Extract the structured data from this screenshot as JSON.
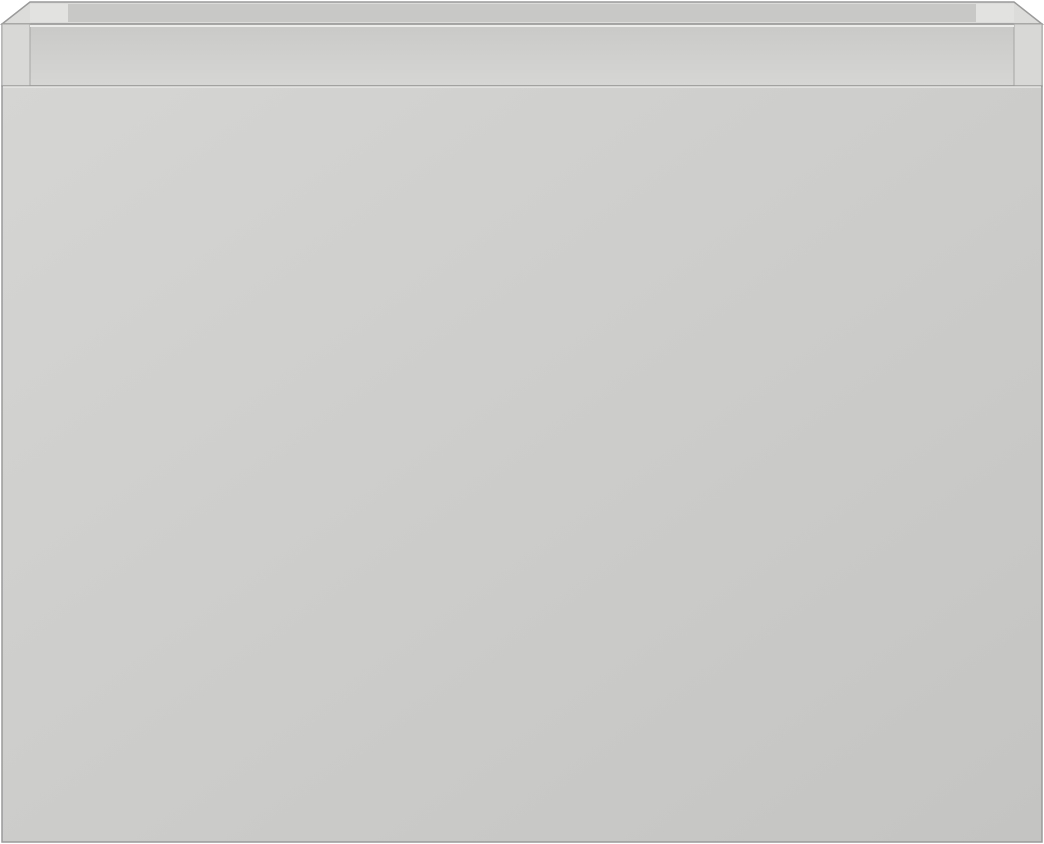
{
  "object": {
    "kind": "drawer-cabinet-render",
    "colors": {
      "background": "#ffffff",
      "outline": "#9a9a9a",
      "front_light": "#d4d4d2",
      "front_dark": "#c4c4c2",
      "top_rim_outer": "#bcbcba",
      "top_rim_inner": "#dadad8",
      "top_inner_back": "#cececc",
      "side_panel": "#cfcfcd",
      "highlight": "#ececea"
    }
  }
}
